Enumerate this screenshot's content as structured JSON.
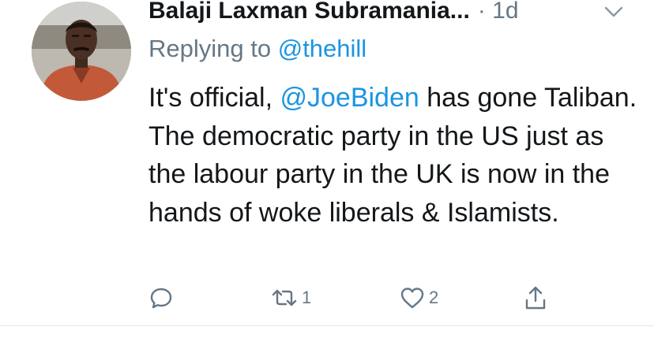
{
  "tweet": {
    "author_name": "Balaji Laxman Subramania...",
    "separator": "·",
    "time": "1d",
    "replying_label": "Replying to",
    "replying_handle": "@thehill",
    "text_before_mention": "It's official, ",
    "mention": "@JoeBiden",
    "text_after_mention": " has gone Taliban. The democratic party in the US just as the labour party in the UK is now in the hands of woke liberals & Islamists.",
    "retweet_count": "1",
    "like_count": "2"
  },
  "icons": {
    "menu": "chevron-down-icon",
    "reply": "reply-icon",
    "retweet": "retweet-icon",
    "like": "heart-icon",
    "share": "share-icon"
  },
  "colors": {
    "text": "#14171a",
    "muted": "#657786",
    "link": "#1b95e0",
    "divider": "#e1e8ed"
  }
}
